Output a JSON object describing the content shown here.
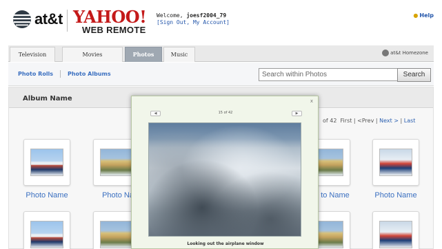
{
  "header": {
    "brand_att": "at&t",
    "brand_yahoo": "YAHOO!",
    "product": "WEB REMOTE",
    "welcome_prefix": "Welcome, ",
    "username": "joesf2004_79",
    "account_links": "[Sign Out, My Account]",
    "help": "Help"
  },
  "tabs": [
    {
      "label": "Television"
    },
    {
      "label": "Movies"
    },
    {
      "label": "Photos",
      "active": true
    },
    {
      "label": "Music"
    }
  ],
  "homezone_brand": "at&t Homezone",
  "subnav": {
    "photo_rolls": "Photo Rolls",
    "photo_albums": "Photo Albums",
    "search_placeholder": "Search within Photos",
    "search_button": "Search"
  },
  "album": {
    "name": "Album Name",
    "pager": {
      "count": "of 42",
      "first": "First",
      "prev": "<Prev",
      "next": "Next >",
      "last": "Last"
    },
    "photo_label": "Photo Name",
    "photo_label_partial_left": "Photo Na",
    "photo_label_partial_right": "to Name"
  },
  "viewer": {
    "close": "x",
    "counter": "15 of 42",
    "caption": "Looking out the airplane window"
  },
  "colors": {
    "link_blue": "#3a6fc0",
    "yahoo_red": "#c41a1a",
    "active_tab": "#9fa8b2",
    "modal_bg": "#f1f6ea"
  }
}
